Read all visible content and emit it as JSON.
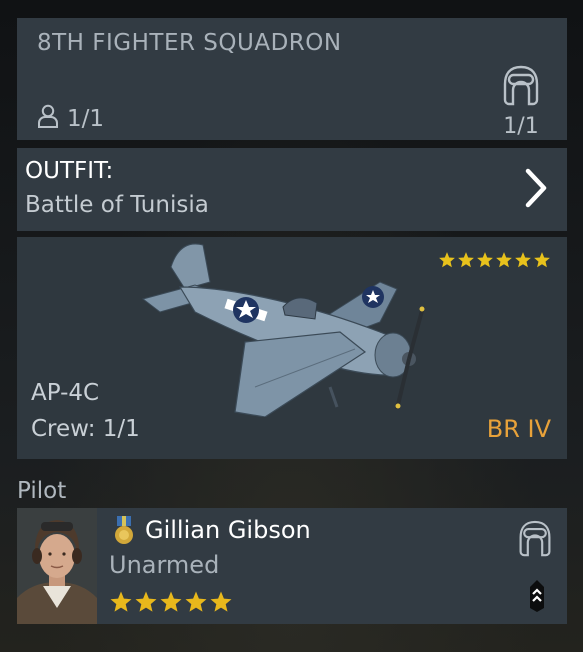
{
  "squadron": {
    "title": "8TH FIGHTER SQUADRON",
    "members": "1/1",
    "pilot_slots": "1/1"
  },
  "outfit": {
    "label": "OUTFIT:",
    "value": "Battle of Tunisia"
  },
  "aircraft": {
    "name": "AP-4C",
    "crew": "Crew: 1/1",
    "battle_rating": "BR IV",
    "stars": 6,
    "star_color": "#e8c21c",
    "br_color": "#e8a23a"
  },
  "pilot_section": {
    "title": "Pilot",
    "name": "Gillian Gibson",
    "weapon": "Unarmed",
    "stars": 5,
    "star_color": "#e8b81c",
    "icons": [
      "medal-icon",
      "pilot-helmet-icon",
      "rank-chevron-icon"
    ]
  }
}
